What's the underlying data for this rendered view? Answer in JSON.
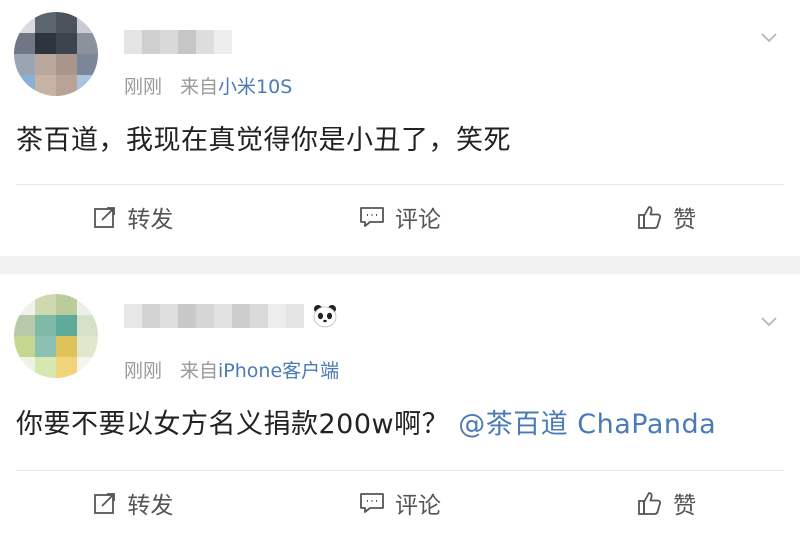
{
  "posts": [
    {
      "time": "刚刚",
      "source_prefix": "来自",
      "source": "小米10S",
      "text": "茶百道，我现在真觉得你是小丑了，笑死",
      "mention": "",
      "actions": {
        "repost": "转发",
        "comment": "评论",
        "like": "赞"
      }
    },
    {
      "time": "刚刚",
      "source_prefix": "来自",
      "source": "iPhone客户端",
      "text": "你要不要以女方名义捐款200w啊？",
      "mention": "@茶百道 ChaPanda",
      "actions": {
        "repost": "转发",
        "comment": "评论",
        "like": "赞"
      }
    }
  ],
  "colors": {
    "link": "#4a7bb7",
    "muted": "#9a9a9a",
    "text": "#222222",
    "background": "#f2f2f2"
  },
  "icons": {
    "repost": "repost-icon",
    "comment": "comment-icon",
    "like": "thumbs-up-icon",
    "more": "chevron-down-icon",
    "badge": "panda-icon"
  }
}
